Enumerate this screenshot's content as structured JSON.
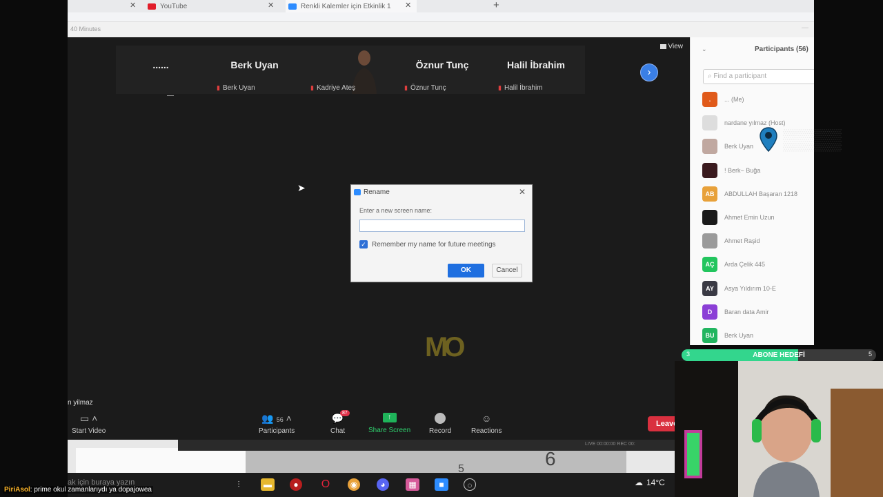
{
  "browser": {
    "tabs": [
      {
        "title": "YouTube",
        "color": "#e11d2a"
      },
      {
        "title": "Renkli Kalemler için Etkinlik 1",
        "color": "#2d8cff"
      }
    ],
    "infobar_text": "40 Minutes"
  },
  "meeting": {
    "strip": [
      {
        "big_name": "......",
        "label": ""
      },
      {
        "big_name": "Berk Uyan",
        "label": "Berk Uyan"
      },
      {
        "big_name": "",
        "label": "Kadriye Ateş"
      },
      {
        "big_name": "Öznur Tunç",
        "label": "Öznur Tunç"
      },
      {
        "big_name": "Halil İbrahim",
        "label": "Halil İbrahim"
      }
    ],
    "view_label": "View",
    "active_speaker": "n yilmaz",
    "logo_text": "MO"
  },
  "toolbar": {
    "start_video": "Start Video",
    "participants": "Participants",
    "participants_count": "56",
    "chat": "Chat",
    "chat_badge": "87",
    "share_screen": "Share Screen",
    "record": "Record",
    "reactions": "Reactions",
    "leave": "Leave",
    "status_text": "LIVE 00:00:00   REC 00:"
  },
  "dialog": {
    "title": "Rename",
    "prompt": "Enter a new screen name:",
    "input_value": "",
    "remember_label": "Remember my name for future meetings",
    "remember_checked": true,
    "ok": "OK",
    "cancel": "Cancel"
  },
  "participants_panel": {
    "title": "Participants (56)",
    "search_placeholder": "Find a participant",
    "items": [
      {
        "name": "... (Me)",
        "initials": ".",
        "color": "#e05a1a"
      },
      {
        "name": "nardane yılmaz (Host)",
        "initials": "",
        "color": "#dddddd"
      },
      {
        "name": "Berk Uyan",
        "initials": "",
        "color": "#c0a8a0"
      },
      {
        "name": "! Berk~ Buğa",
        "initials": "",
        "color": "#3a1a1e"
      },
      {
        "name": "ABDULLAH Başaran 1218",
        "initials": "AB",
        "color": "#e8a13a"
      },
      {
        "name": "Ahmet Emin Uzun",
        "initials": "",
        "color": "#1a1a1a"
      },
      {
        "name": "Ahmet Raşid",
        "initials": "",
        "color": "#9a9a9a"
      },
      {
        "name": "Arda Çelik 445",
        "initials": "AÇ",
        "color": "#22c55e"
      },
      {
        "name": "Asya Yıldırım 10-E",
        "initials": "AY",
        "color": "#3a3a44"
      },
      {
        "name": "Baran data Amir",
        "initials": "D",
        "color": "#8b3fd6"
      },
      {
        "name": "Berk Uyan",
        "initials": "BU",
        "color": "#22b560"
      }
    ]
  },
  "desktop": {
    "number_big": "6",
    "number_small": "5",
    "search_hint": "ak için buraya yazın",
    "weather": "14°C"
  },
  "stream": {
    "goal_label": "ABONE HEDEFİ",
    "goal_current": "3",
    "goal_target": "5",
    "goal_progress": 0.6,
    "chat_user": "PiriAsol",
    "chat_message": ": prime okul zamanlarıydı ya dopajowea"
  }
}
